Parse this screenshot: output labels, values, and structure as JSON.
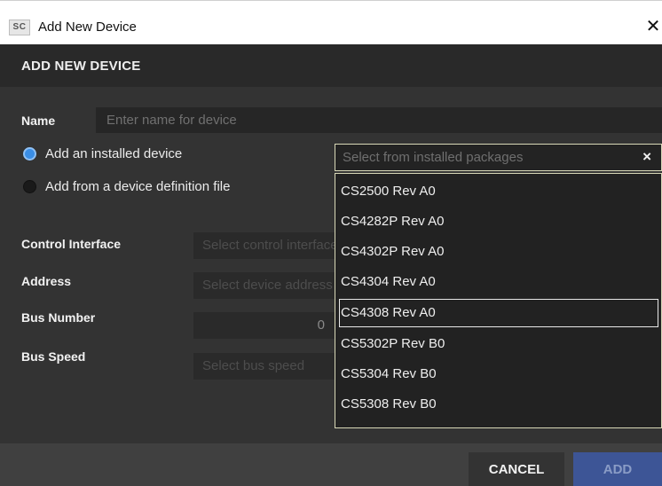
{
  "window": {
    "app_icon_text": "SC",
    "title": "Add New Device",
    "close_glyph": "✕"
  },
  "dialog": {
    "heading": "ADD NEW DEVICE",
    "name_label": "Name",
    "name_placeholder": "Enter name for device",
    "name_value": "",
    "source_options": [
      {
        "label": "Add an installed device",
        "selected": true
      },
      {
        "label": "Add from a device definition file",
        "selected": false
      }
    ],
    "fields": {
      "control_interface": {
        "label": "Control Interface",
        "placeholder": "Select control interface"
      },
      "address": {
        "label": "Address",
        "placeholder": "Select device address"
      },
      "bus_number": {
        "label": "Bus Number",
        "value": "0"
      },
      "bus_speed": {
        "label": "Bus Speed",
        "placeholder": "Select bus speed"
      }
    },
    "package_select": {
      "placeholder": "Select from installed packages",
      "clear_icon": "×",
      "highlighted": "CS4308 Rev A0",
      "options": [
        "CS2500 Rev A0",
        "CS4282P Rev A0",
        "CS4302P Rev A0",
        "CS4304 Rev A0",
        "CS4308 Rev A0",
        "CS5302P Rev B0",
        "CS5304 Rev B0",
        "CS5308 Rev B0"
      ]
    },
    "footer": {
      "cancel_label": "CANCEL",
      "add_label": "ADD"
    }
  },
  "colors": {
    "dialog_bg": "#333333",
    "header_bg": "#292929",
    "accent_blue": "#3a8ee6",
    "add_button": "#3d5596",
    "dropdown_border": "#d9d9b8"
  }
}
